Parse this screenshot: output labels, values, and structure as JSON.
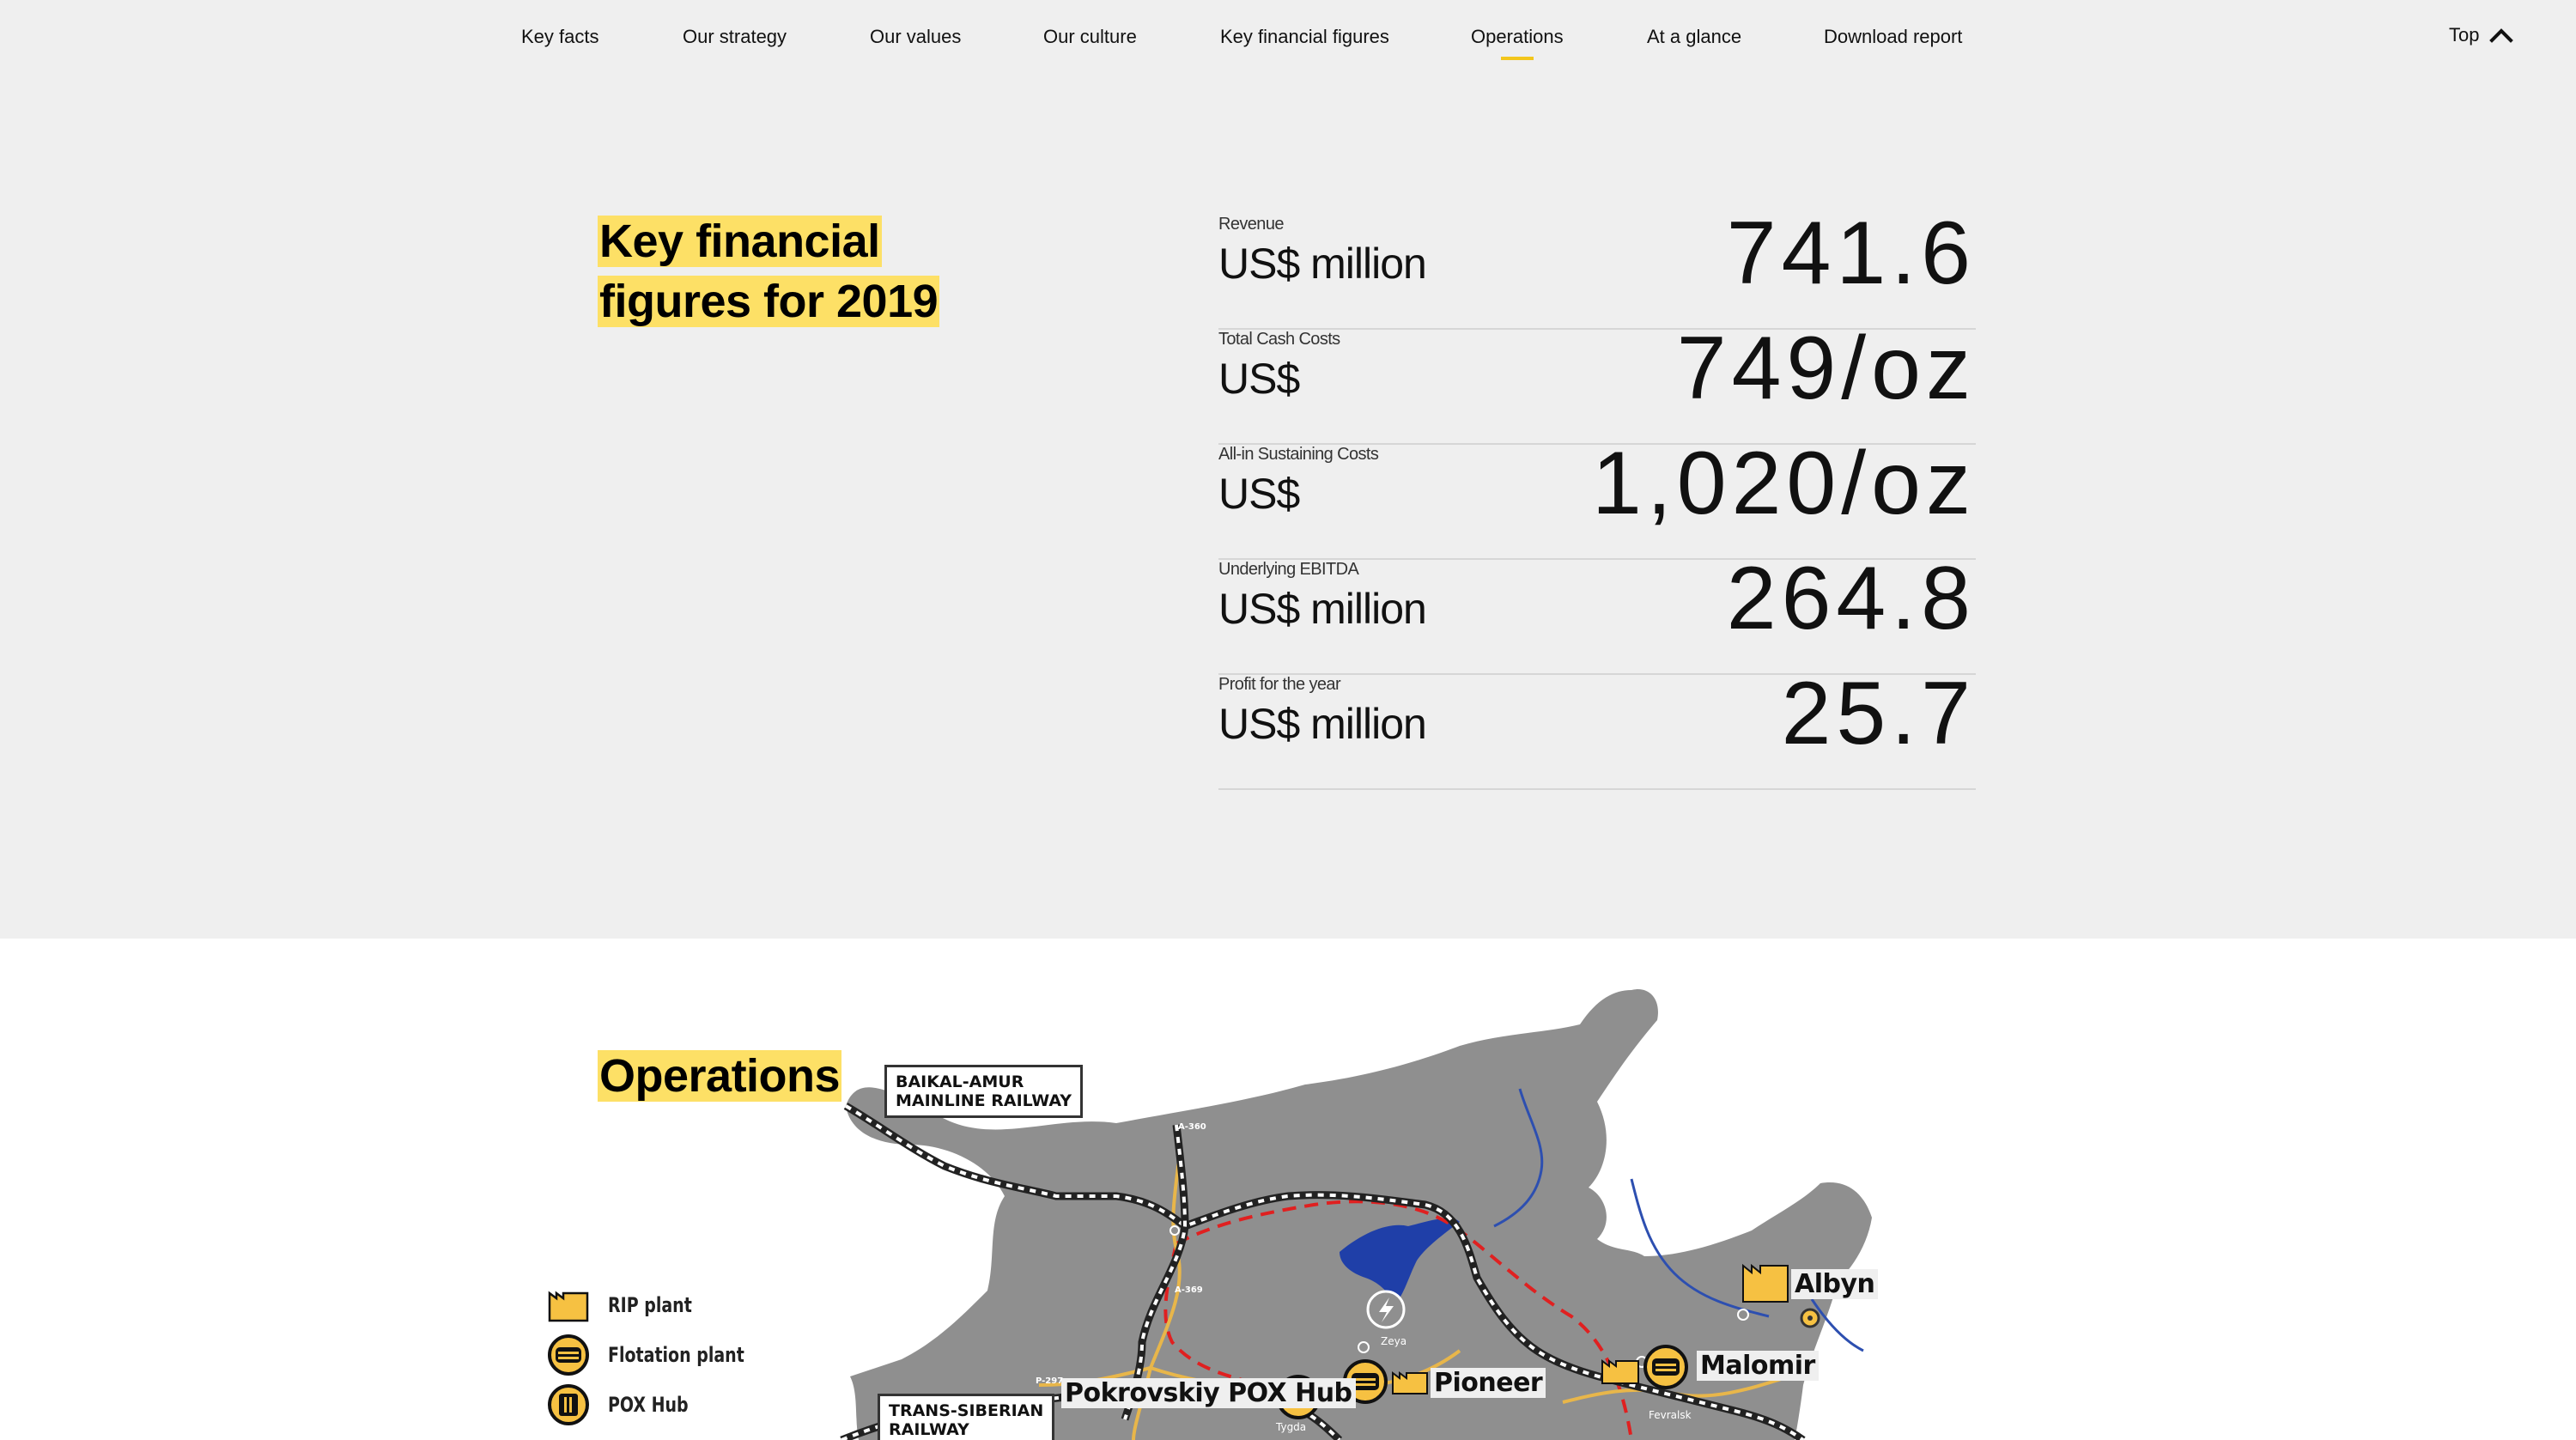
{
  "nav": {
    "items": [
      {
        "label": "Key facts"
      },
      {
        "label": "Our strategy"
      },
      {
        "label": "Our values"
      },
      {
        "label": "Our culture"
      },
      {
        "label": "Key financial figures"
      },
      {
        "label": "Operations",
        "active": true
      },
      {
        "label": "At a glance"
      },
      {
        "label": "Download report"
      }
    ],
    "top_label": "Top",
    "top_icon": "chevron-up-icon"
  },
  "key_financials": {
    "title_line1": "Key financial",
    "title_line2": "figures for 2019",
    "metrics": [
      {
        "label": "Revenue",
        "unit": "US$ million",
        "value": "741.6"
      },
      {
        "label": "Total Cash Costs",
        "unit": "US$",
        "value": "749/oz"
      },
      {
        "label": "All-in Sustaining Costs",
        "unit": "US$",
        "value": "1,020/oz"
      },
      {
        "label": "Underlying EBITDA",
        "unit": "US$ million",
        "value": "264.8"
      },
      {
        "label": "Profit for the year",
        "unit": "US$ million",
        "value": "25.7"
      }
    ]
  },
  "operations": {
    "title": "Operations",
    "legend": [
      {
        "label": "RIP plant",
        "icon": "rip-plant-icon"
      },
      {
        "label": "Flotation plant",
        "icon": "flotation-plant-icon"
      },
      {
        "label": "POX Hub",
        "icon": "pox-hub-icon"
      }
    ],
    "map": {
      "railways": {
        "bam_line1": "BAIKAL-AMUR",
        "bam_line2": "MAINLINE RAILWAY",
        "ts_line1": "TRANS-SIBERIAN",
        "ts_line2": "RAILWAY"
      },
      "sites": {
        "pokrovskiy": "Pokrovskiy POX Hub",
        "pioneer": "Pioneer",
        "malomir": "Malomir",
        "albyn": "Albyn"
      },
      "towns": {
        "zeya": "Zeya",
        "fevralsk": "Fevralsk",
        "tygda": "Tygda"
      },
      "roads": {
        "a360": "A-360",
        "a369": "A-369",
        "p297": "P-297"
      },
      "colors": {
        "land": "#8f8f8f",
        "reservoir": "#1f3fa8",
        "river": "#2d4fb0",
        "road": "#e8b64a",
        "border": "#e02020",
        "marker": "#f6c142",
        "highlight": "#fde066"
      }
    }
  }
}
